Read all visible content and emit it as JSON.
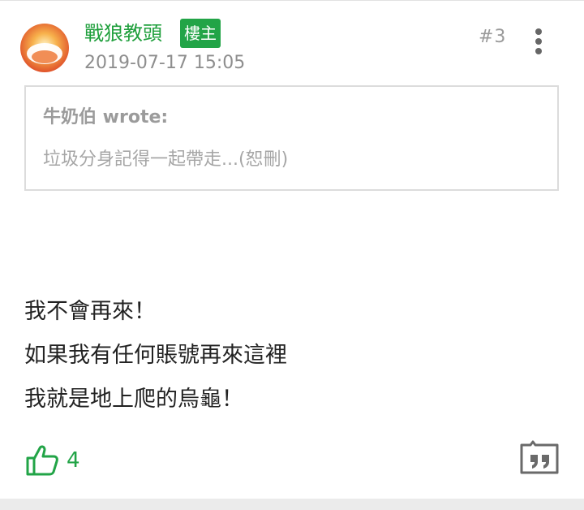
{
  "post": {
    "author_name": "戰狼教頭",
    "op_badge": "樓主",
    "timestamp": "2019-07-17 15:05",
    "floor_number": "#3",
    "quote": {
      "author": "牛奶伯 wrote:",
      "text": "垃圾分身記得一起帶走...(恕刪)"
    },
    "body_lines": [
      "我不會再來！",
      "如果我有任何賬號再來這裡",
      "我就是地上爬的烏龜！"
    ],
    "like_count": "4",
    "icons": {
      "avatar": "avatar-image",
      "more": "more-vertical-icon",
      "like": "thumbs-up-icon",
      "reply": "quote-reply-icon"
    },
    "colors": {
      "accent": "#22a447",
      "author": "#1f9f3c"
    }
  }
}
